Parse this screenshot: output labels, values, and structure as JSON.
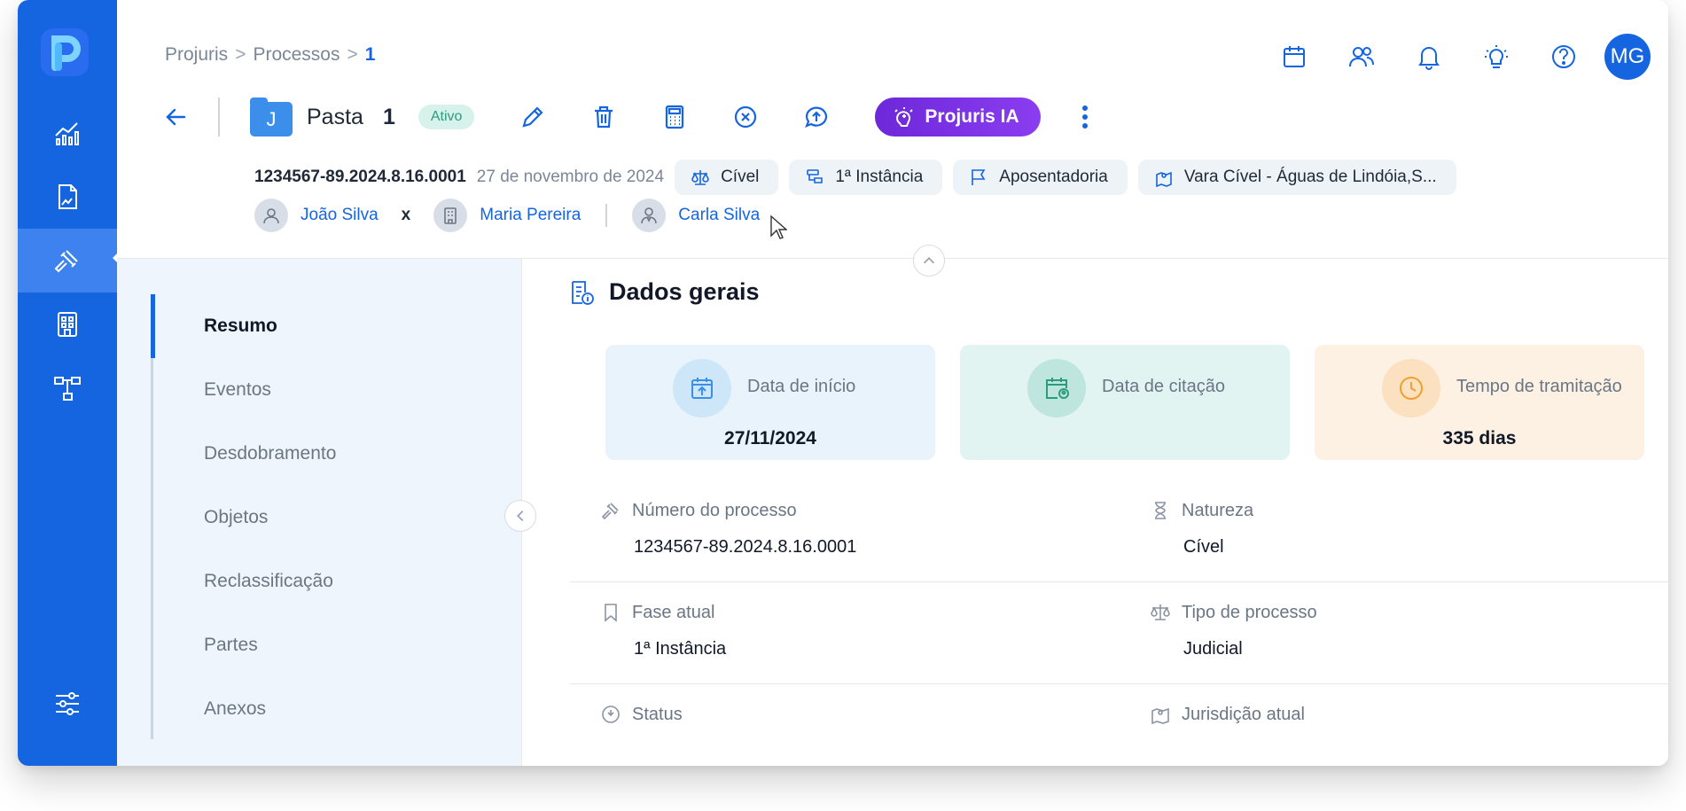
{
  "breadcrumb": {
    "items": [
      "Projuris",
      "Processos"
    ],
    "current": "1",
    "separator": ">"
  },
  "user": {
    "initials": "MG"
  },
  "toolbar": {
    "folder_letter": "J",
    "pasta_label": "Pasta",
    "pasta_number": "1",
    "status_badge": "Ativo",
    "ia_label": "Projuris IA"
  },
  "process": {
    "number": "1234567-89.2024.8.16.0001",
    "date": "27 de novembro de 2024",
    "chips": [
      "Cível",
      "1ª Instância",
      "Aposentadoria",
      "Vara Cível - Águas de Lindóia,S..."
    ]
  },
  "parties": {
    "plaintiff": "João Silva",
    "versus": "x",
    "defendant": "Maria Pereira",
    "lawyer": "Carla Silva"
  },
  "leftnav": {
    "items": [
      "Resumo",
      "Eventos",
      "Desdobramento",
      "Objetos",
      "Reclassificação",
      "Partes",
      "Anexos"
    ],
    "active_index": 0
  },
  "section": {
    "title": "Dados gerais"
  },
  "cards": [
    {
      "label": "Data de início",
      "value": "27/11/2024",
      "color": "#e9f3fc"
    },
    {
      "label": "Data de citação",
      "value": "",
      "color": "#e2f4f2"
    },
    {
      "label": "Tempo de tramitação",
      "value": "335 dias",
      "color": "#fcf1e2"
    }
  ],
  "fields": {
    "numero": {
      "label": "Número do processo",
      "value": "1234567-89.2024.8.16.0001"
    },
    "natureza": {
      "label": "Natureza",
      "value": "Cível"
    },
    "fase": {
      "label": "Fase atual",
      "value": "1ª Instância"
    },
    "tipo": {
      "label": "Tipo de processo",
      "value": "Judicial"
    },
    "status": {
      "label": "Status"
    },
    "jurisdicao": {
      "label": "Jurisdição atual"
    }
  },
  "colors": {
    "brand": "#1565e0",
    "ia": "#7c3aed",
    "badge_ok": "#2c9c7d"
  }
}
